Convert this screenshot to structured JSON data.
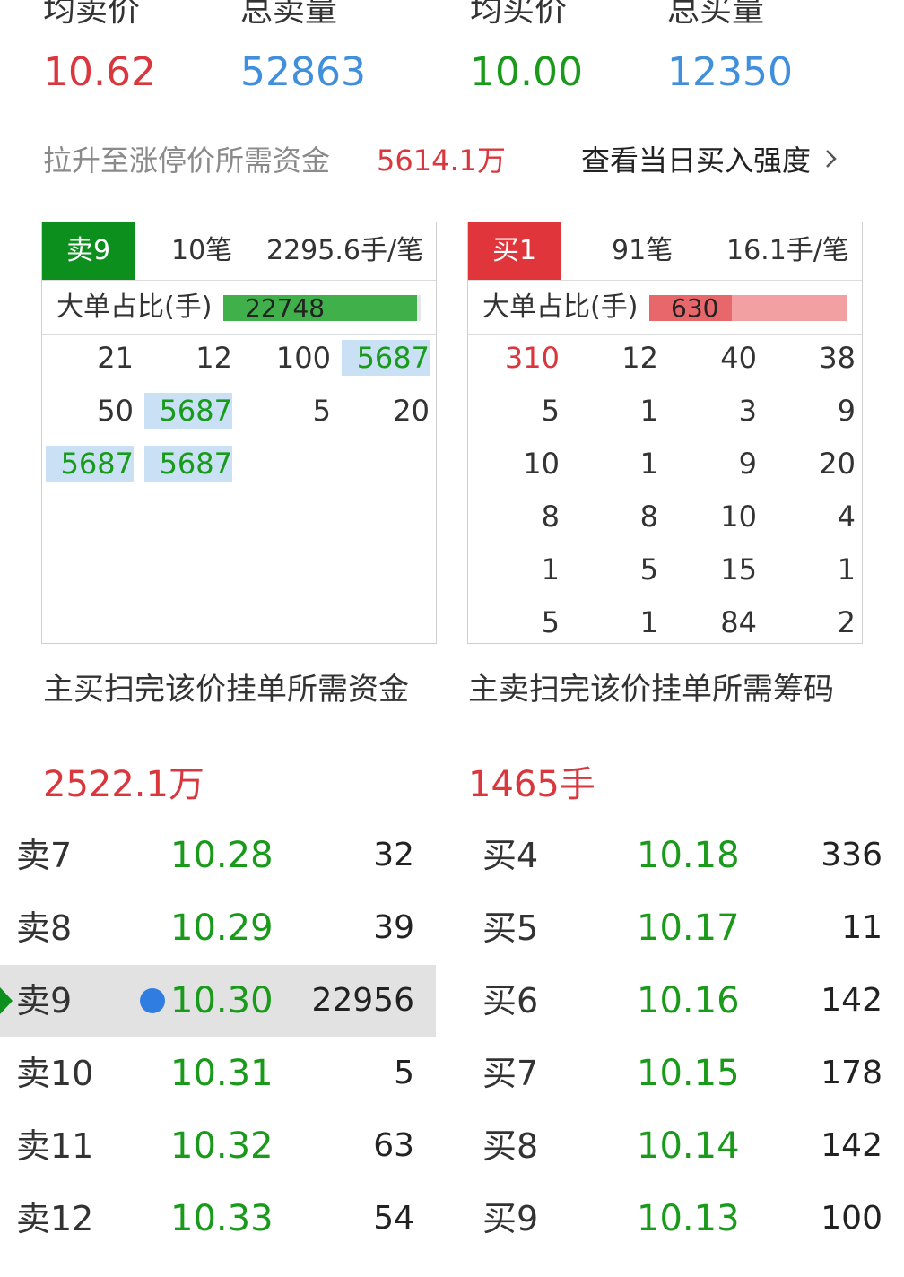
{
  "stats": [
    {
      "label": "均卖价",
      "value": "10.62",
      "color": "#d9363e"
    },
    {
      "label": "总卖量",
      "value": "52863",
      "color": "#3f8fdc"
    },
    {
      "label": "均买价",
      "value": "10.00",
      "color": "#1a9a1a"
    },
    {
      "label": "总买量",
      "value": "12350",
      "color": "#3f8fdc"
    }
  ],
  "limit_up": {
    "label": "拉升至涨停价所需资金",
    "value": "5614.1万",
    "link_label": "查看当日买入强度",
    "link_icon": "chevron-right-icon"
  },
  "sell_panel": {
    "tag": "卖9",
    "count": "10笔",
    "avg": "2295.6手/笔",
    "ratio_label": "大单占比(手)",
    "ratio_value": "22748",
    "ratio_fill": 0.98,
    "bar_color": "#3fb04a",
    "cells": [
      [
        "21",
        "12",
        "100",
        "5687"
      ],
      [
        "50",
        "5687",
        "5",
        "20"
      ],
      [
        "5687",
        "5687",
        "",
        ""
      ]
    ],
    "highlight_value": "5687",
    "footer_title": "主买扫完该价挂单所需资金",
    "footer_value": "2522.1万"
  },
  "buy_panel": {
    "tag": "买1",
    "count": "91笔",
    "avg": "16.1手/笔",
    "ratio_label": "大单占比(手)",
    "ratio_value": "630",
    "ratio_fill": 0.42,
    "bar_color": "#e8676b",
    "bar_bg_color": "#f2a0a2",
    "cells": [
      [
        "310",
        "12",
        "40",
        "38"
      ],
      [
        "5",
        "1",
        "3",
        "9"
      ],
      [
        "10",
        "1",
        "9",
        "20"
      ],
      [
        "8",
        "8",
        "10",
        "4"
      ],
      [
        "1",
        "5",
        "15",
        "1"
      ],
      [
        "5",
        "1",
        "84",
        "2"
      ]
    ],
    "footer_title": "主卖扫完该价挂单所需筹码",
    "footer_value": "1465手"
  },
  "sell_book": [
    {
      "name": "卖7",
      "price": "10.28",
      "vol": "32"
    },
    {
      "name": "卖8",
      "price": "10.29",
      "vol": "39"
    },
    {
      "name": "卖9",
      "price": "10.30",
      "vol": "22956",
      "selected": true
    },
    {
      "name": "卖10",
      "price": "10.31",
      "vol": "5"
    },
    {
      "name": "卖11",
      "price": "10.32",
      "vol": "63"
    },
    {
      "name": "卖12",
      "price": "10.33",
      "vol": "54"
    }
  ],
  "buy_book": [
    {
      "name": "买4",
      "price": "10.18",
      "vol": "336"
    },
    {
      "name": "买5",
      "price": "10.17",
      "vol": "11"
    },
    {
      "name": "买6",
      "price": "10.16",
      "vol": "142"
    },
    {
      "name": "买7",
      "price": "10.15",
      "vol": "178"
    },
    {
      "name": "买8",
      "price": "10.14",
      "vol": "142"
    },
    {
      "name": "买9",
      "price": "10.13",
      "vol": "100"
    }
  ]
}
